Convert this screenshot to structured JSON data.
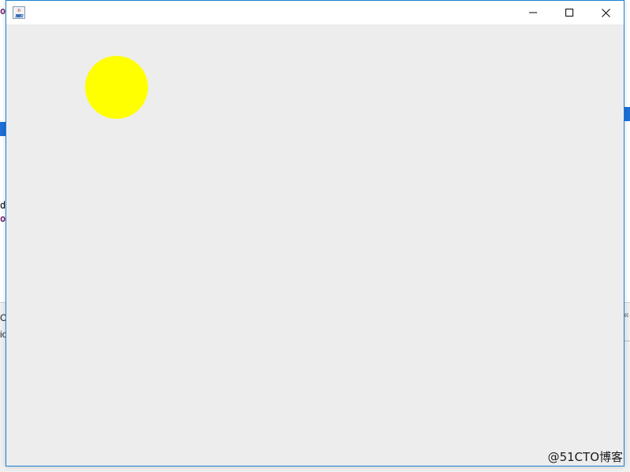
{
  "background_ide": {
    "code_lines": [
      {
        "text": "oi",
        "bold": true
      },
      {
        "text": "dy",
        "bold": false
      },
      {
        "text": "oi",
        "bold": true
      }
    ],
    "console_lines": [
      "C",
      "io"
    ],
    "right_glyph": "«"
  },
  "window": {
    "title": "",
    "app_icon": "java-coffee-cup-icon",
    "controls": {
      "minimize": "minimize-icon",
      "maximize": "maximize-icon",
      "close": "close-icon"
    },
    "canvas": {
      "background_color": "#ededed",
      "shapes": [
        {
          "type": "circle",
          "fill": "#ffff00"
        }
      ]
    }
  },
  "colors": {
    "accent_border": "#1883d7",
    "ide_highlight": "#1e6fd9"
  },
  "watermark": "@51CTO博客"
}
